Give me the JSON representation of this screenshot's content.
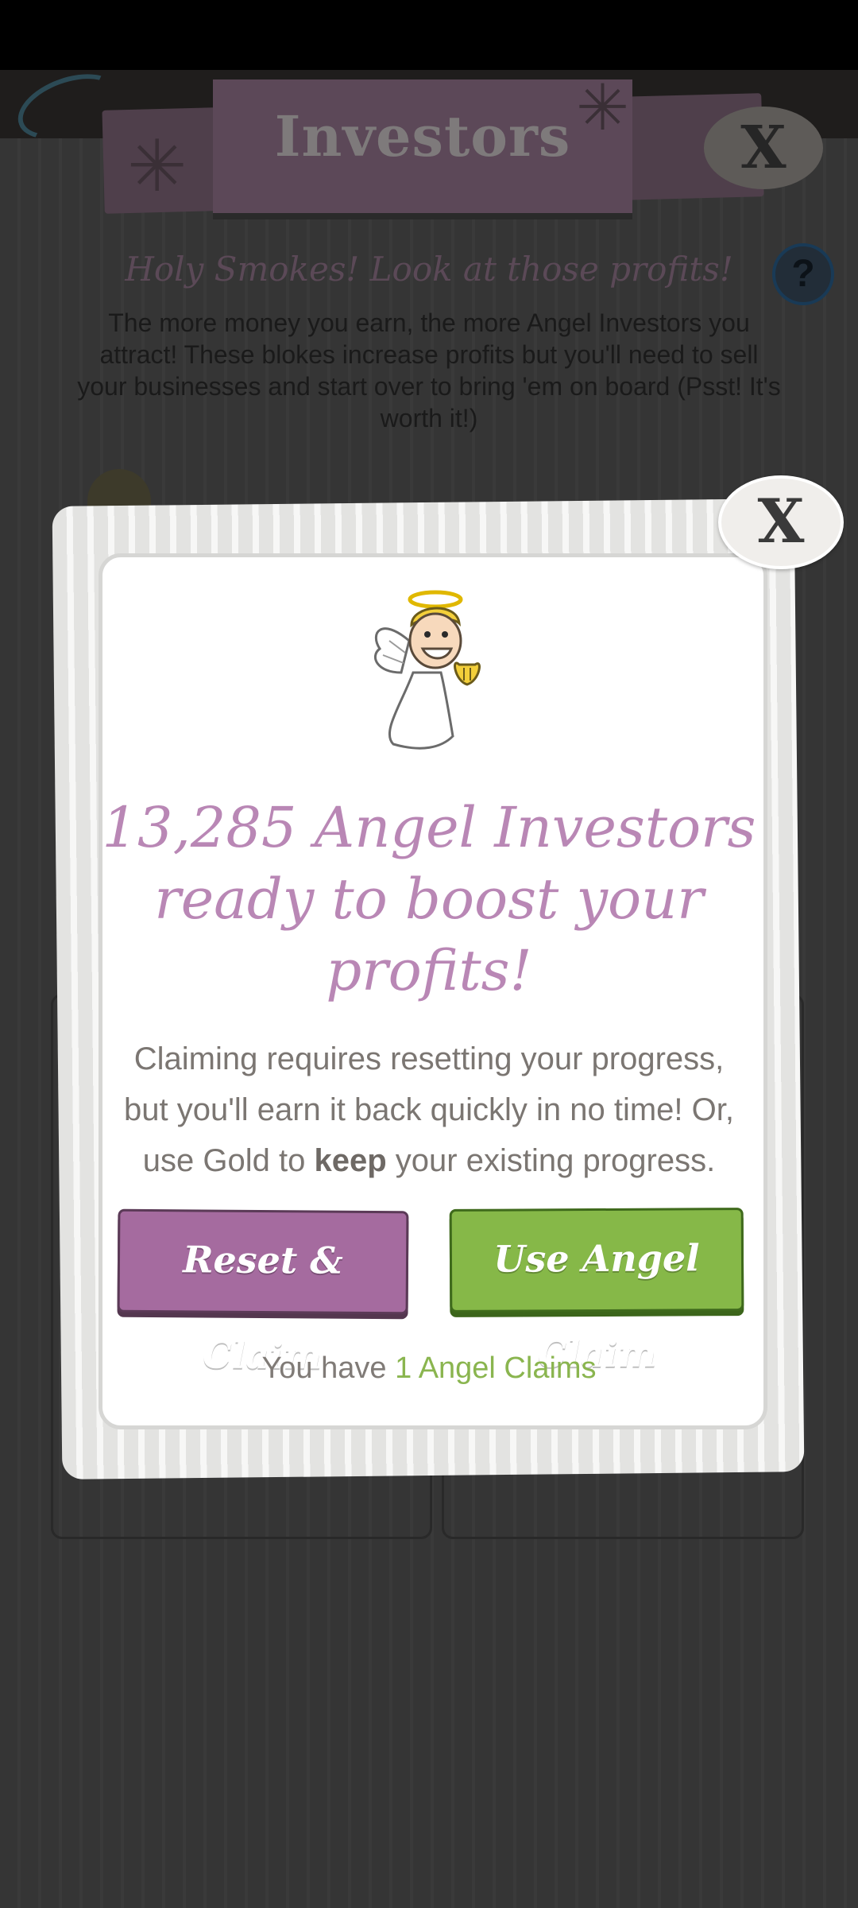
{
  "screen": {
    "title": "Investors",
    "subtitle": "Holy Smokes! Look at those profits!",
    "help_label": "?",
    "close_label": "X",
    "description": "The more money you earn, the more Angel Investors you attract! These blokes increase profits but you'll need to sell your businesses and start over to bring 'em on board (Psst! It's worth it!)"
  },
  "modal": {
    "close_label": "X",
    "headline": "13,285 Angel Investors ready to boost your profits!",
    "body_before": "Claiming requires resetting your progress, but you'll earn it back quickly in no time! Or, use Gold to",
    "body_bold": "keep",
    "body_after": "your existing progress.",
    "reset_button": "Reset & Claim",
    "angel_claim_button": "Use Angel Claim",
    "claims_prefix": "You have",
    "claims_value": "1 Angel Claims"
  },
  "colors": {
    "headline": "#b987b5",
    "reset_button": "#a56b9f",
    "angel_claim_button": "#86b848",
    "claims_highlight": "#8ab54f"
  },
  "icons": [
    "close-icon",
    "help-icon",
    "angel-icon",
    "star-decoration-icon"
  ]
}
